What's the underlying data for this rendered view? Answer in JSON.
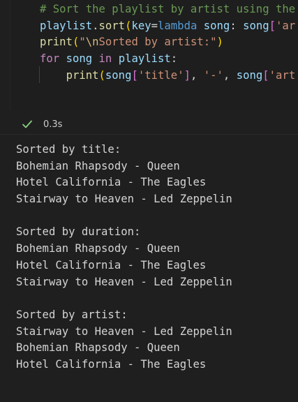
{
  "code_cell": {
    "lines": [
      [
        {
          "t": "# Sort the playlist by artist using the",
          "c": "tok-comment"
        }
      ],
      [
        {
          "t": "playlist",
          "c": "tok-var"
        },
        {
          "t": ".",
          "c": "tok-punct"
        },
        {
          "t": "sort",
          "c": "tok-func"
        },
        {
          "t": "(",
          "c": "tok-bracket2"
        },
        {
          "t": "key",
          "c": "tok-var"
        },
        {
          "t": "=",
          "c": "tok-punct"
        },
        {
          "t": "lambda",
          "c": "tok-keyword"
        },
        {
          "t": " ",
          "c": "tok-punct"
        },
        {
          "t": "song",
          "c": "tok-var"
        },
        {
          "t": ": ",
          "c": "tok-punct"
        },
        {
          "t": "song",
          "c": "tok-var"
        },
        {
          "t": "[",
          "c": "tok-bracket"
        },
        {
          "t": "'ar",
          "c": "tok-string"
        }
      ],
      [
        {
          "t": "print",
          "c": "tok-func"
        },
        {
          "t": "(",
          "c": "tok-bracket2"
        },
        {
          "t": "\"",
          "c": "tok-string"
        },
        {
          "t": "\\n",
          "c": "tok-escape"
        },
        {
          "t": "Sorted by artist:\"",
          "c": "tok-string"
        },
        {
          "t": ")",
          "c": "tok-bracket2"
        }
      ],
      [
        {
          "t": "for",
          "c": "tok-ctrl"
        },
        {
          "t": " ",
          "c": "tok-punct"
        },
        {
          "t": "song",
          "c": "tok-var"
        },
        {
          "t": " ",
          "c": "tok-punct"
        },
        {
          "t": "in",
          "c": "tok-ctrl"
        },
        {
          "t": " ",
          "c": "tok-punct"
        },
        {
          "t": "playlist",
          "c": "tok-var"
        },
        {
          "t": ":",
          "c": "tok-punct"
        }
      ],
      [
        {
          "t": "    ",
          "c": "tok-punct"
        },
        {
          "t": "print",
          "c": "tok-func"
        },
        {
          "t": "(",
          "c": "tok-bracket2"
        },
        {
          "t": "song",
          "c": "tok-var"
        },
        {
          "t": "[",
          "c": "tok-bracket"
        },
        {
          "t": "'title'",
          "c": "tok-string"
        },
        {
          "t": "]",
          "c": "tok-bracket"
        },
        {
          "t": ", ",
          "c": "tok-punct"
        },
        {
          "t": "'-'",
          "c": "tok-string"
        },
        {
          "t": ", ",
          "c": "tok-punct"
        },
        {
          "t": "song",
          "c": "tok-var"
        },
        {
          "t": "[",
          "c": "tok-bracket"
        },
        {
          "t": "'art",
          "c": "tok-string"
        }
      ]
    ]
  },
  "status": {
    "check_icon": "check-icon",
    "check_color": "#89d185",
    "exec_time": "0.3s"
  },
  "output": {
    "lines": [
      "Sorted by title:",
      "Bohemian Rhapsody - Queen",
      "Hotel California - The Eagles",
      "Stairway to Heaven - Led Zeppelin",
      "",
      "Sorted by duration:",
      "Bohemian Rhapsody - Queen",
      "Hotel California - The Eagles",
      "Stairway to Heaven - Led Zeppelin",
      "",
      "Sorted by artist:",
      "Stairway to Heaven - Led Zeppelin",
      "Bohemian Rhapsody - Queen",
      "Hotel California - The Eagles"
    ]
  }
}
